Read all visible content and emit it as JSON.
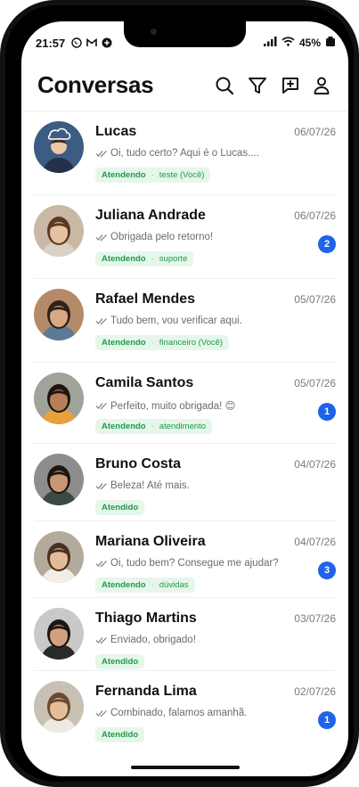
{
  "status": {
    "time": "21:57",
    "battery": "45%"
  },
  "header": {
    "title": "Conversas"
  },
  "conversations": [
    {
      "name": "Lucas",
      "date": "06/07/26",
      "message": "Oi, tudo certo? Aqui é o Lucas....",
      "status": "Atendendo",
      "queue": "teste (Você)",
      "unread": ""
    },
    {
      "name": "Juliana Andrade",
      "date": "06/07/26",
      "message": "Obrigada pelo retorno!",
      "status": "Atendendo",
      "queue": "suporte",
      "unread": "2"
    },
    {
      "name": "Rafael Mendes",
      "date": "05/07/26",
      "message": "Tudo bem, vou verificar aqui.",
      "status": "Atendendo",
      "queue": "financeiro (Você)",
      "unread": ""
    },
    {
      "name": "Camila Santos",
      "date": "05/07/26",
      "message": "Perfeito, muito obrigada! 😊",
      "status": "Atendendo",
      "queue": "atendimento",
      "unread": "1"
    },
    {
      "name": "Bruno Costa",
      "date": "04/07/26",
      "message": "Beleza! Até mais.",
      "status": "Atendido",
      "queue": "",
      "unread": ""
    },
    {
      "name": "Mariana Oliveira",
      "date": "04/07/26",
      "message": "Oi, tudo bem? Consegue me ajudar?",
      "status": "Atendendo",
      "queue": "dúvidas",
      "unread": "3"
    },
    {
      "name": "Thiago Martins",
      "date": "03/07/26",
      "message": "Enviado, obrigado!",
      "status": "Atendido",
      "queue": "",
      "unread": ""
    },
    {
      "name": "Fernanda Lima",
      "date": "02/07/26",
      "message": "Combinado, falamos amanhã.",
      "status": "Atendido",
      "queue": "",
      "unread": "1"
    }
  ],
  "colors": {
    "accent": "#1e63e9",
    "tag_bg": "#e6f6eb",
    "tag_text": "#1f9a48"
  },
  "icons": [
    "search-icon",
    "filter-icon",
    "new-chat-icon",
    "profile-icon"
  ]
}
